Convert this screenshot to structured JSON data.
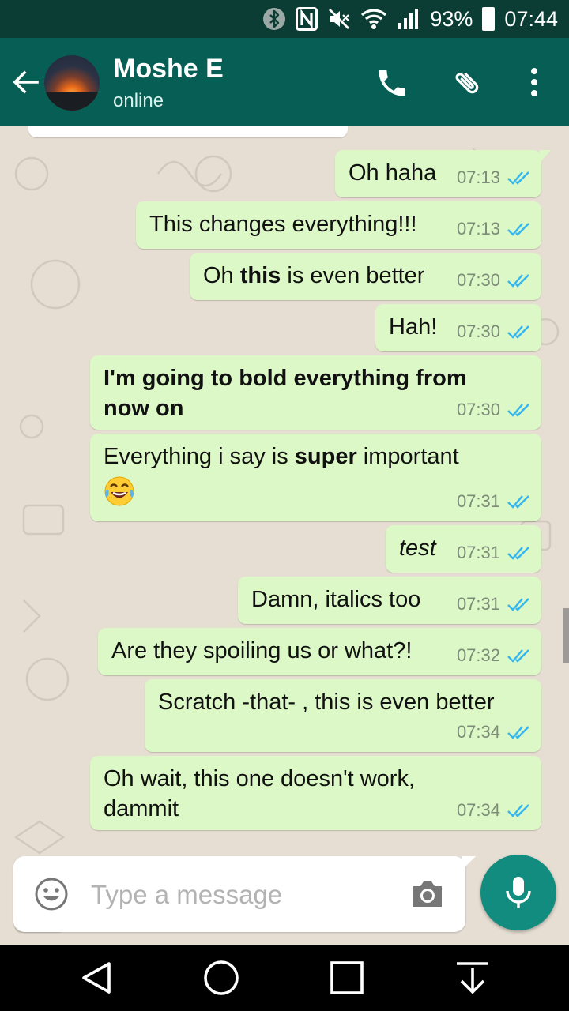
{
  "status_bar": {
    "icons": [
      "bluetooth-icon",
      "nfc-icon",
      "mute-icon",
      "wifi-icon",
      "signal-icon"
    ],
    "battery": "93%",
    "time": "07:44"
  },
  "header": {
    "contact_name": "Moshe E",
    "contact_status": "online",
    "icons": [
      "back-arrow-icon",
      "phone-icon",
      "paperclip-icon",
      "more-vert-icon"
    ]
  },
  "colors": {
    "header": "#075e54",
    "status_bar": "#0b3d35",
    "outgoing_bubble": "#dcf8c6",
    "read_tick": "#34b7f1",
    "mic_button": "#128c7e"
  },
  "messages": [
    {
      "text": "Oh haha",
      "time": "07:13",
      "status": "read"
    },
    {
      "text": "This changes everything!!!",
      "time": "07:13",
      "status": "read"
    },
    {
      "parts": [
        "Oh ",
        "this",
        " is even better"
      ],
      "time": "07:30",
      "status": "read"
    },
    {
      "text": "Hah!",
      "time": "07:30",
      "status": "read"
    },
    {
      "text": "I'm going to bold everything from now on",
      "time": "07:30",
      "status": "read"
    },
    {
      "parts": [
        "Everything i say is ",
        "super",
        " important"
      ],
      "emoji": "face-with-tears-of-joy",
      "time": "07:31",
      "status": "read"
    },
    {
      "text": "test",
      "time": "07:31",
      "status": "read"
    },
    {
      "text": "Damn, italics too",
      "time": "07:31",
      "status": "read"
    },
    {
      "text": "Are they spoiling us or what?!",
      "time": "07:32",
      "status": "read"
    },
    {
      "text": "Scratch -that- , this is even better",
      "time": "07:34",
      "status": "read"
    },
    {
      "text": "Oh wait, this one doesn't work, dammit",
      "time": "07:34",
      "status": "read"
    }
  ],
  "composer": {
    "placeholder": "Type a message",
    "value": "",
    "icons": [
      "emoji-icon",
      "camera-icon",
      "mic-icon"
    ]
  },
  "nav_bar": {
    "icons": [
      "back-triangle-icon",
      "home-circle-icon",
      "recents-square-icon",
      "notification-pull-icon"
    ]
  }
}
